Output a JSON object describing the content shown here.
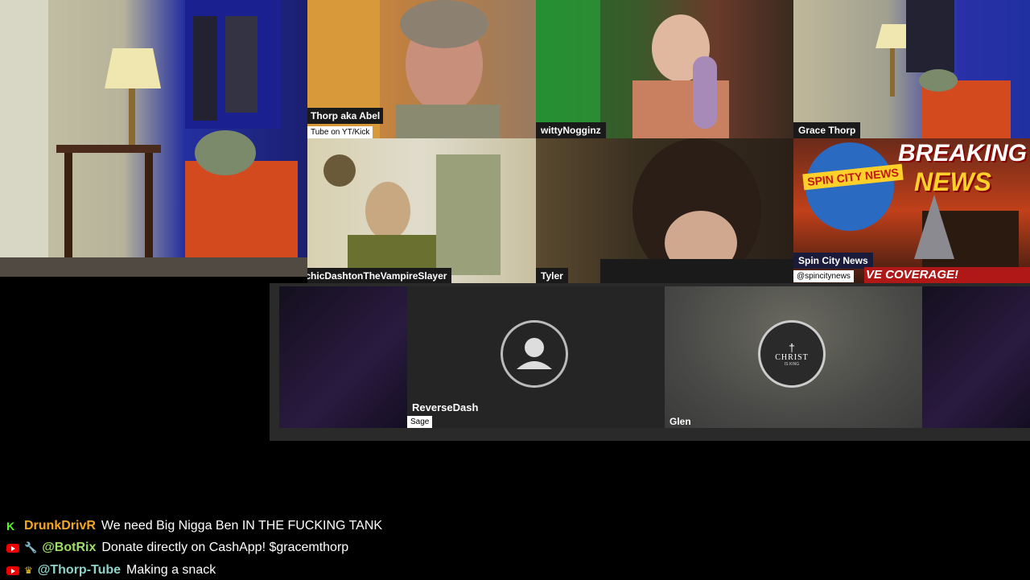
{
  "participants": [
    {
      "name": "Thorp aka Abel",
      "sub": "Tube on YT/Kick"
    },
    {
      "name": "wittyNogginz"
    },
    {
      "name": "Grace Thorp"
    },
    {
      "name": "PsychicDashtonTheVampireSlayer"
    },
    {
      "name": "Tyler"
    },
    {
      "name": "Spin City News",
      "sub": "@spincitynews"
    },
    {
      "name": "ReverseDash",
      "sub": "Sage"
    },
    {
      "name": "Glen"
    }
  ],
  "news_banner": {
    "logo": "SPIN CITY NEWS",
    "headline_1": "BREAKING",
    "headline_2": "NEWS",
    "ticker": "VE COVERAGE!"
  },
  "avatar_text": {
    "line1": "CHRIST",
    "line2": "IS KING"
  },
  "chat": [
    {
      "platform": "kick",
      "badges": [],
      "user": "DrunkDrivR",
      "user_color": "#f5a623",
      "message": "We need Big Nigga Ben IN THE FUCKING TANK"
    },
    {
      "platform": "youtube",
      "badges": [
        "wrench-icon"
      ],
      "user": "@BotRix",
      "user_color": "#9ee06a",
      "message": "Donate directly on CashApp! $gracemthorp"
    },
    {
      "platform": "youtube",
      "badges": [
        "crown-icon"
      ],
      "user": "@Thorp-Tube",
      "user_color": "#8fd3c8",
      "message": "Making a snack"
    }
  ]
}
